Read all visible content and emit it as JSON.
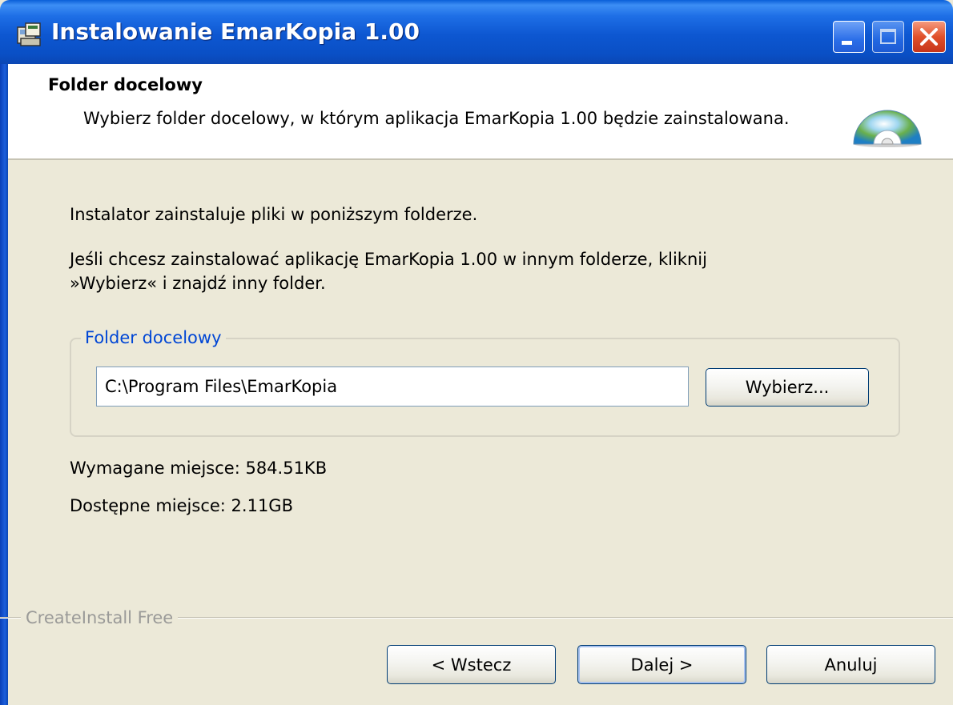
{
  "window": {
    "title": "Instalowanie EmarKopia 1.00"
  },
  "header": {
    "title": "Folder docelowy",
    "description": "Wybierz folder docelowy, w którym aplikacja EmarKopia 1.00 będzie zainstalowana."
  },
  "body": {
    "intro": "Instalator zainstaluje pliki w poniższym folderze.",
    "hint_line1": "Jeśli chcesz zainstalować aplikację EmarKopia 1.00 w innym folderze, kliknij",
    "hint_line2": "»Wybierz« i znajdź inny folder."
  },
  "destination": {
    "group_label": "Folder docelowy",
    "path": "C:\\Program Files\\EmarKopia",
    "browse_label": "Wybierz..."
  },
  "space": {
    "required": "Wymagane miejsce: 584.51KB",
    "available": "Dostępne miejsce: 2.11GB"
  },
  "footer": {
    "branding": "CreateInstall Free",
    "back_label": "< Wstecz",
    "next_label": "Dalej >",
    "cancel_label": "Anuluj"
  },
  "colors": {
    "titlebar": "#0a4fc5",
    "dialog_bg": "#ece9d8",
    "group_label": "#0046d5",
    "close_button": "#e0502a"
  }
}
